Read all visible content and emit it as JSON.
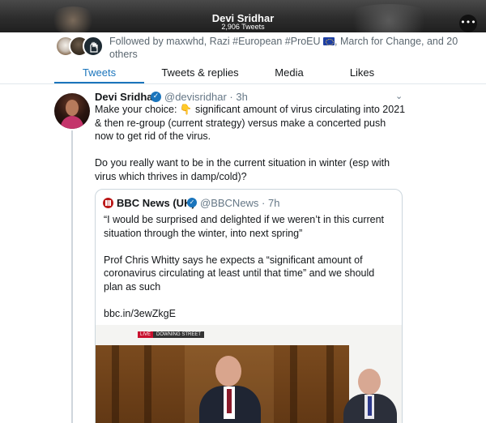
{
  "header": {
    "title": "Devi Sridhar",
    "subtitle": "2,906 Tweets",
    "more_icon": "ellipsis-icon"
  },
  "followers": {
    "prefix": "Followed by maxwhd, Razi #European #ProEU ",
    "suffix": ", March for Change, and 20 others",
    "flag_icon": "eu-flag-icon"
  },
  "tabs": [
    {
      "label": "Tweets",
      "active": true
    },
    {
      "label": "Tweets & replies",
      "active": false
    },
    {
      "label": "Media",
      "active": false
    },
    {
      "label": "Likes",
      "active": false
    }
  ],
  "tweet": {
    "author_name": "Devi Sridhar",
    "handle_time": "@devisridhar · 3h",
    "paragraphs": [
      "Make your choice: 👇 significant amount of virus circulating into 2021 & then re-group (current strategy) versus make a concerted push now to get rid of the virus.",
      "Do you really want to be in the current situation in winter (esp with virus which thrives in damp/cold)?"
    ],
    "quote": {
      "author_name": "BBC News (UK)",
      "handle_time": "@BBCNews · 7h",
      "paragraphs": [
        "“I would be surprised and delighted if we weren’t in this current situation through the winter, into next spring”",
        "Prof Chris Whitty says he expects a “significant amount of coronavirus circulating at least until that time” and we should plan as such",
        "bbc.in/3ewZkgE"
      ],
      "media": {
        "badge_live": "LIVE",
        "badge_location": "DOWNING STREET"
      }
    }
  },
  "colors": {
    "accent": "#1b75bc",
    "text": "#14171a",
    "secondary": "#657786",
    "bbc_red": "#bb1919"
  }
}
